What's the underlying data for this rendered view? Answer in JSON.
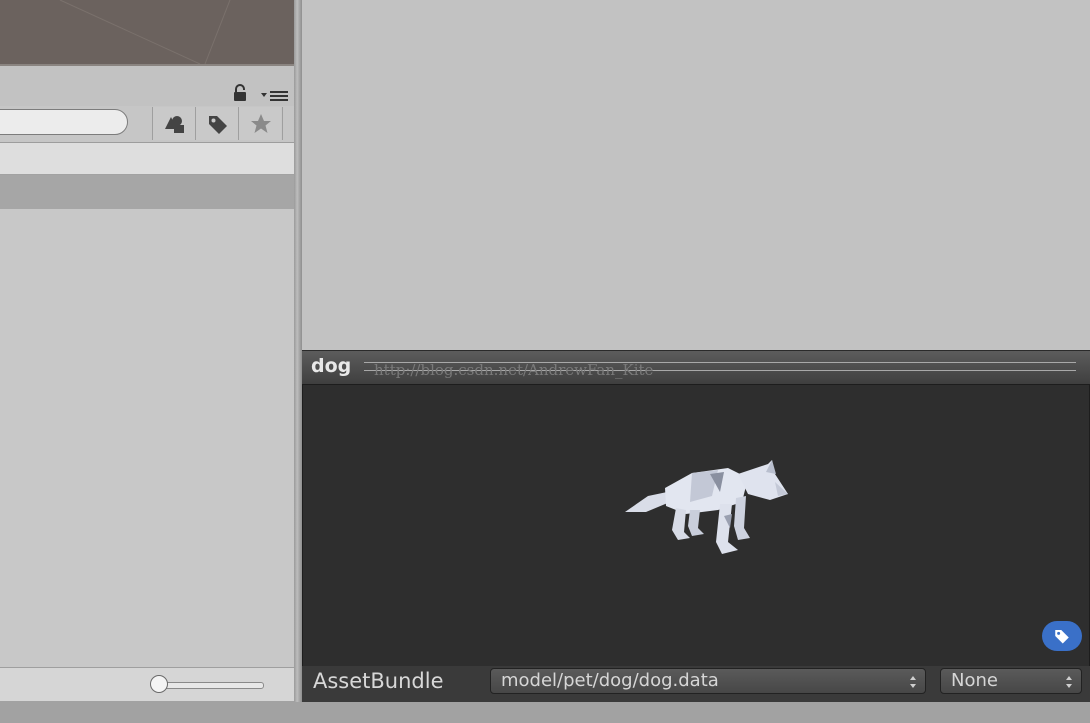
{
  "project": {
    "search": {
      "value": "",
      "placeholder": ""
    },
    "toolbar": {
      "filter_type_icon": "filter-by-type-icon",
      "filter_label_icon": "filter-by-label-icon",
      "favorite_icon": "star-icon"
    },
    "header_icons": [
      "lock-icon",
      "panel-menu-icon"
    ]
  },
  "preview": {
    "title": "dog",
    "watermark": "http://blog.csdn.net/AndrewFan_Kite"
  },
  "asset_bundle": {
    "label": "AssetBundle",
    "name_value": "model/pet/dog/dog.data",
    "variant_value": "None"
  },
  "colors": {
    "preview_bg": "#2e2e2e",
    "label_badge": "#3a70c8",
    "panel_bg": "#c2c2c2"
  }
}
